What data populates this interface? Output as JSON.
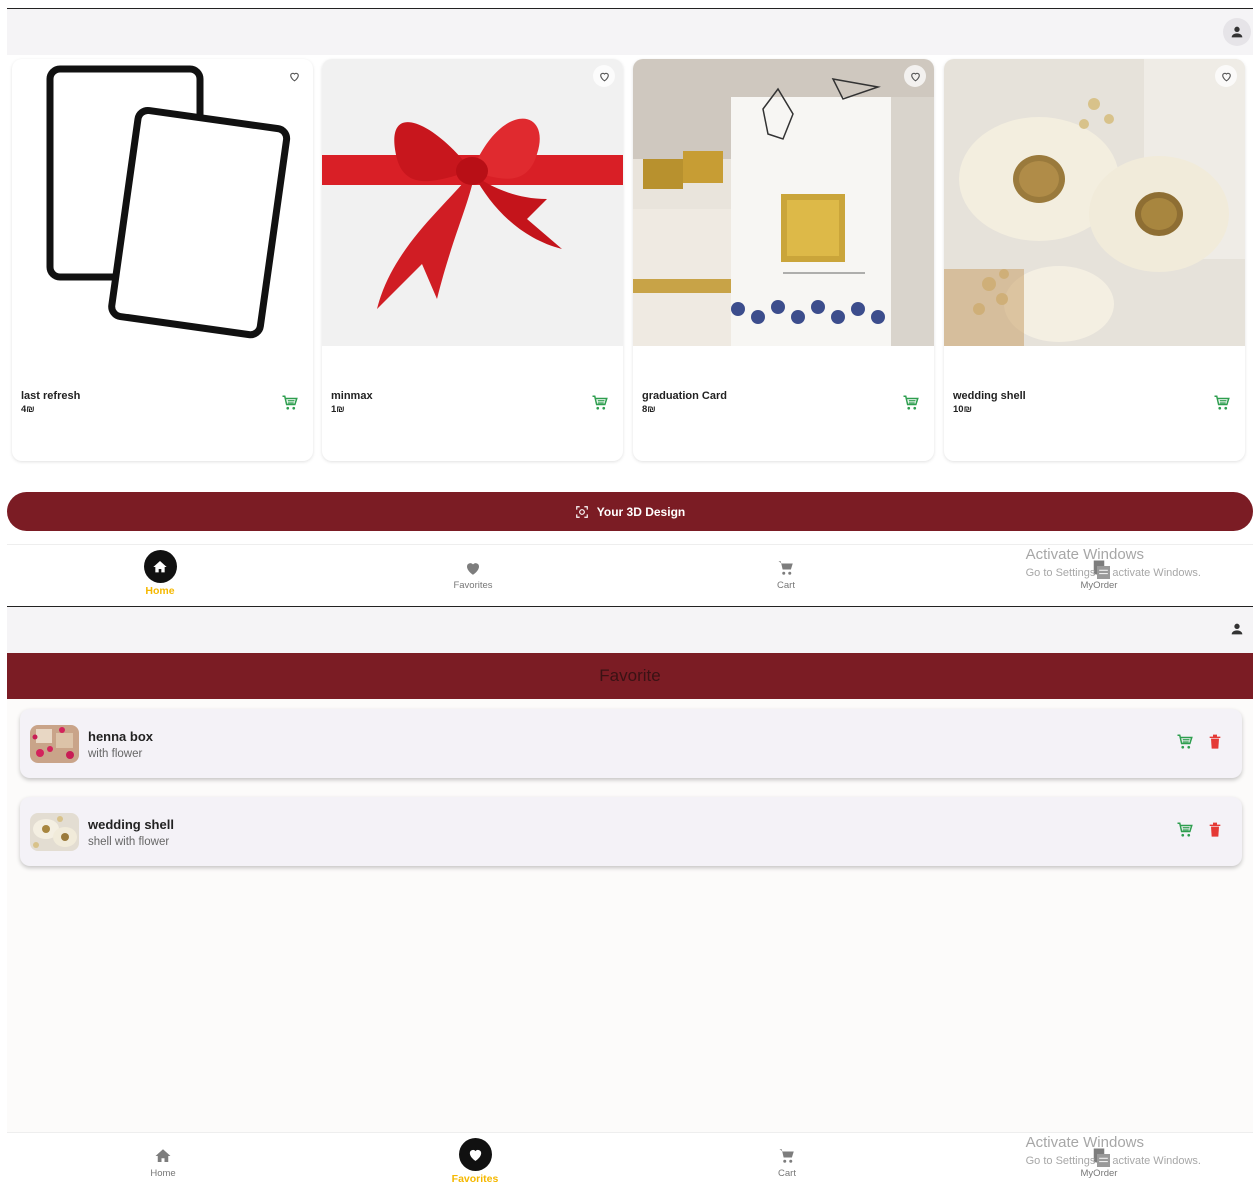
{
  "colors": {
    "brand": "#7b1c24",
    "accent": "#f5b800",
    "cart_green": "#2e9e4f",
    "delete_red": "#e53935"
  },
  "products": [
    {
      "name": "last refresh",
      "price": "4₪",
      "image": "cards-outline-icon"
    },
    {
      "name": "minmax",
      "price": "1₪",
      "image": "red-ribbon-bow"
    },
    {
      "name": "graduation Card",
      "price": "8₪",
      "image": "graduation-card-photo"
    },
    {
      "name": "wedding shell",
      "price": "10₪",
      "image": "wedding-shell-photo"
    }
  ],
  "design_button": {
    "label": "Your 3D Design",
    "icon": "view-3d-icon"
  },
  "bottom_nav_home": {
    "items": [
      {
        "label": "Home",
        "icon": "home-icon",
        "active": true
      },
      {
        "label": "Favorites",
        "icon": "heart-icon",
        "active": false
      },
      {
        "label": "Cart",
        "icon": "cart-icon",
        "active": false
      },
      {
        "label": "MyOrder",
        "icon": "receipt-icon",
        "active": false
      }
    ]
  },
  "favorites_page": {
    "header": "Favorite",
    "items": [
      {
        "title": "henna box",
        "subtitle": "with flower",
        "thumb": "henna-box-photo"
      },
      {
        "title": "wedding shell",
        "subtitle": "shell with flower",
        "thumb": "wedding-shell-photo"
      }
    ]
  },
  "bottom_nav_favorites": {
    "items": [
      {
        "label": "Home",
        "icon": "home-icon",
        "active": false
      },
      {
        "label": "Favorites",
        "icon": "heart-icon",
        "active": true
      },
      {
        "label": "Cart",
        "icon": "cart-icon",
        "active": false
      },
      {
        "label": "MyOrder",
        "icon": "receipt-icon",
        "active": false
      }
    ]
  },
  "watermark": {
    "line1": "Activate Windows",
    "line2a": "Go to Settings",
    "line2b": "activate Windows."
  }
}
